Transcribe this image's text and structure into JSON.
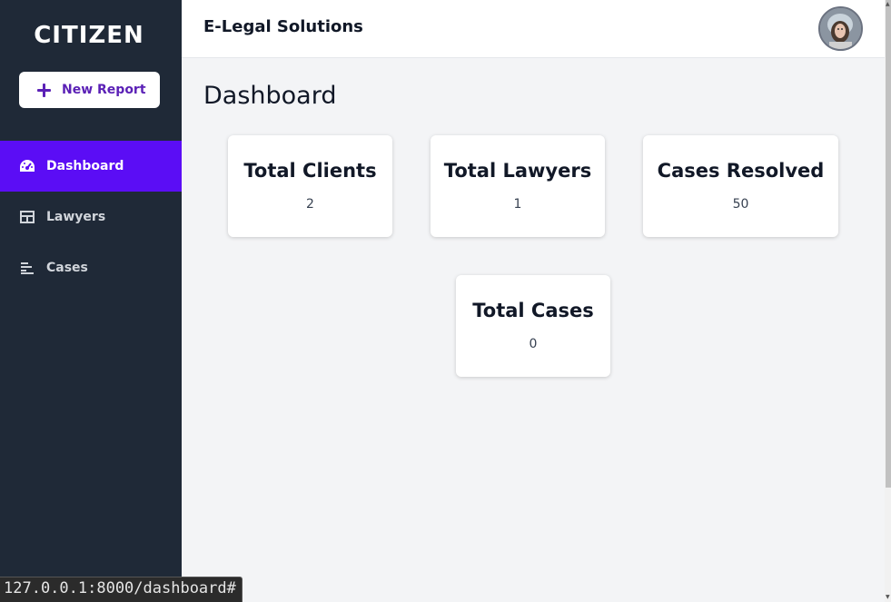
{
  "sidebar": {
    "brand": "CITIZEN",
    "new_report_label": "New Report",
    "items": [
      {
        "label": "Dashboard",
        "icon": "gauge-icon",
        "active": true
      },
      {
        "label": "Lawyers",
        "icon": "table-icon",
        "active": false
      },
      {
        "label": "Cases",
        "icon": "list-icon",
        "active": false
      }
    ]
  },
  "header": {
    "title": "E-Legal Solutions",
    "avatar_icon": "user-avatar"
  },
  "main": {
    "page_title": "Dashboard",
    "cards": [
      {
        "label": "Total Clients",
        "value": "2"
      },
      {
        "label": "Total Lawyers",
        "value": "1"
      },
      {
        "label": "Cases Resolved",
        "value": "50"
      },
      {
        "label": "Total Cases",
        "value": "0"
      }
    ]
  },
  "status_bar": {
    "url": "127.0.0.1:8000/dashboard#"
  },
  "colors": {
    "sidebar_bg": "#1f2937",
    "active_item": "#5b0df5",
    "accent": "#5b21b6",
    "page_bg": "#f3f4f6"
  }
}
